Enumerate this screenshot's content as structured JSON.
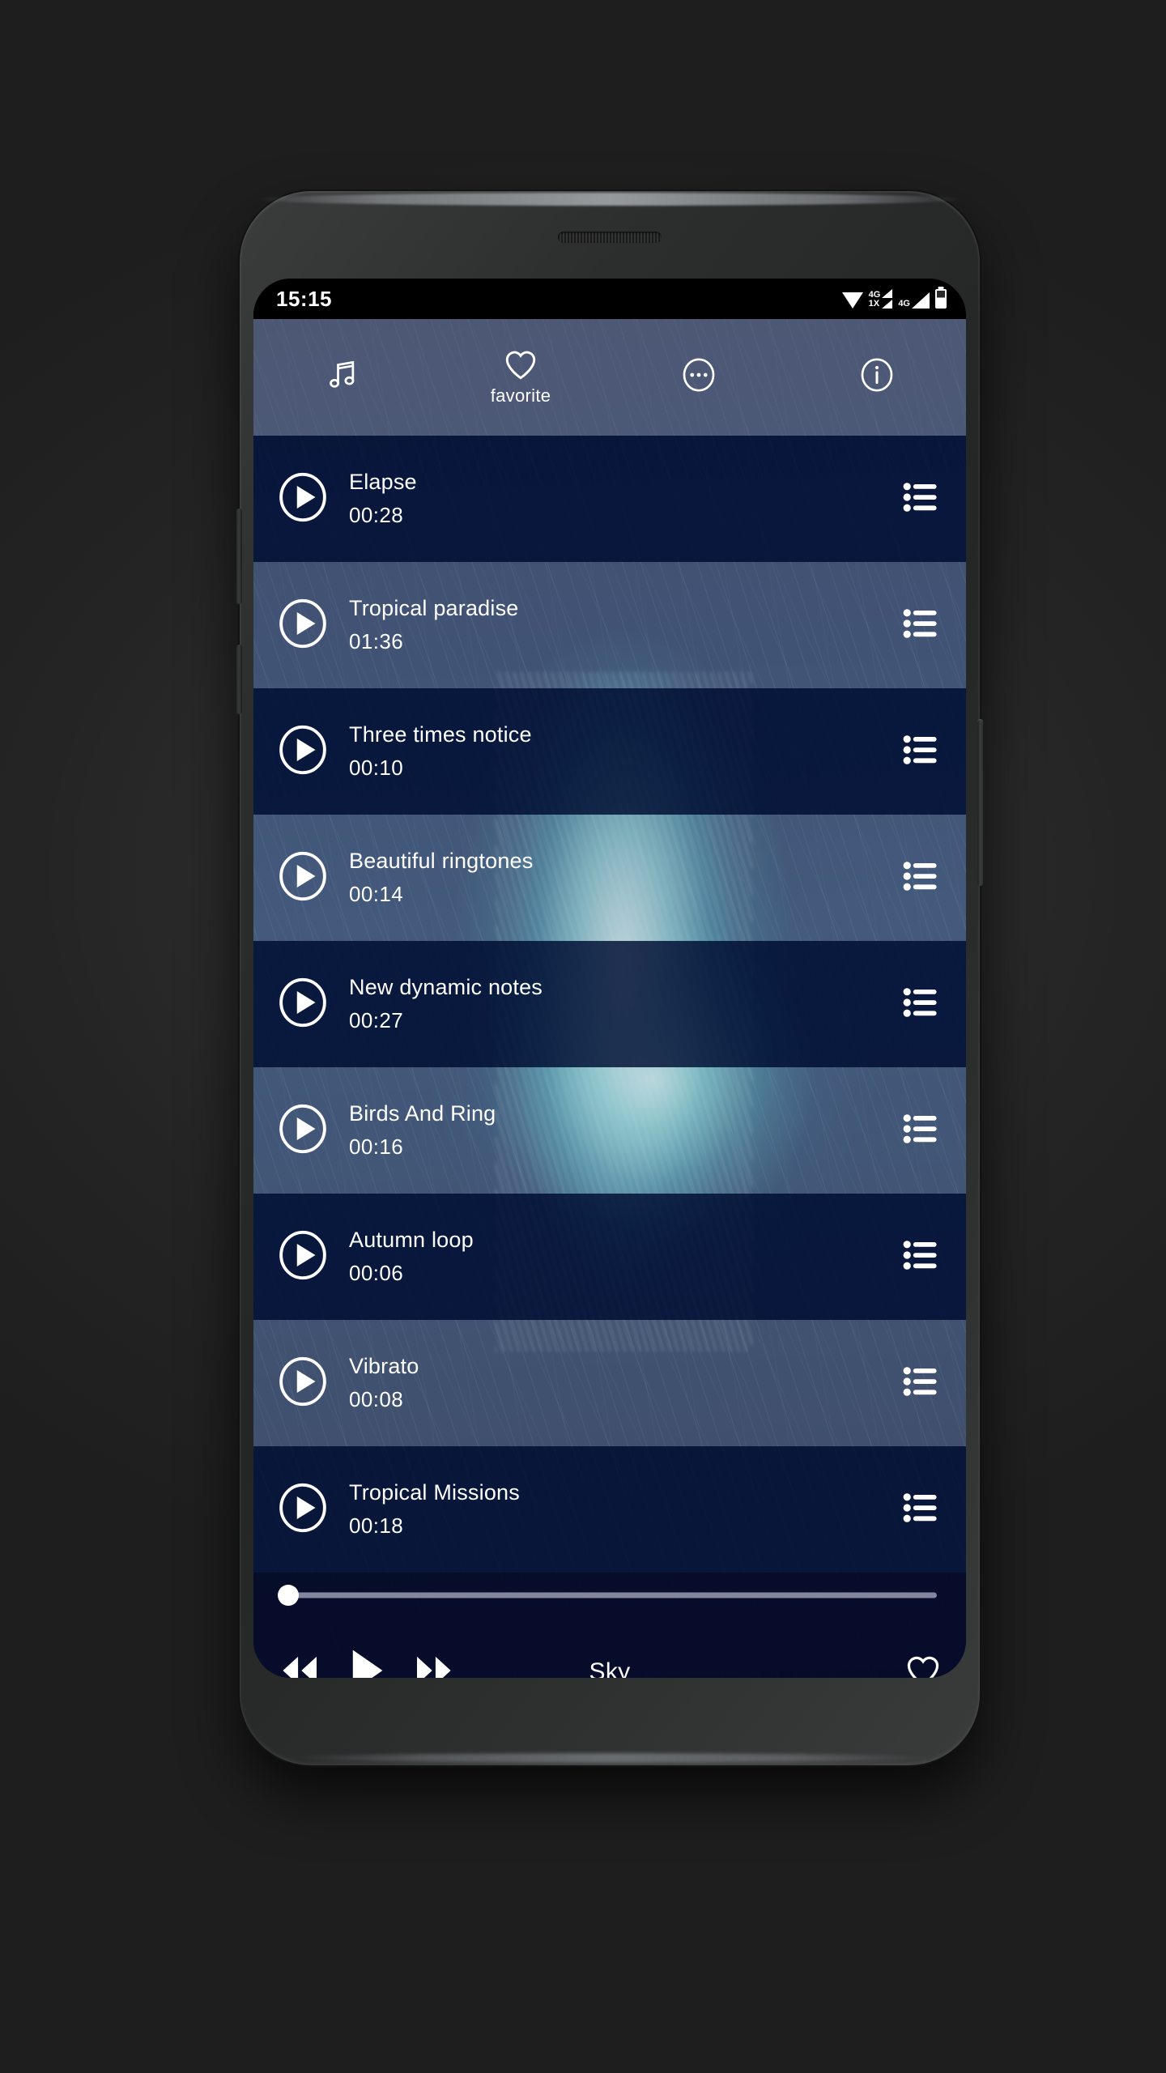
{
  "status_bar": {
    "time": "15:15",
    "icons": [
      "wifi-icon",
      "signal-4g-1x-icon",
      "signal-4g-icon",
      "battery-icon"
    ],
    "signal_1_primary": "4G",
    "signal_1_secondary": "1X",
    "signal_2_primary": "4G"
  },
  "toolbar": {
    "items": [
      {
        "icon": "music-note-icon",
        "label": ""
      },
      {
        "icon": "heart-icon",
        "label": "favorite"
      },
      {
        "icon": "more-circle-icon",
        "label": ""
      },
      {
        "icon": "info-circle-icon",
        "label": ""
      }
    ]
  },
  "list": {
    "items": [
      {
        "title": "Elapse",
        "duration": "00:28",
        "style": "dark",
        "play_icon": "play-circle-icon",
        "menu_icon": "list-menu-icon"
      },
      {
        "title": "Tropical paradise",
        "duration": "01:36",
        "style": "light",
        "play_icon": "play-circle-icon",
        "menu_icon": "list-menu-icon"
      },
      {
        "title": "Three times notice",
        "duration": "00:10",
        "style": "dark",
        "play_icon": "play-circle-icon",
        "menu_icon": "list-menu-icon"
      },
      {
        "title": "Beautiful ringtones",
        "duration": "00:14",
        "style": "light",
        "play_icon": "play-circle-icon",
        "menu_icon": "list-menu-icon"
      },
      {
        "title": "New dynamic notes",
        "duration": "00:27",
        "style": "dark",
        "play_icon": "play-circle-icon",
        "menu_icon": "list-menu-icon"
      },
      {
        "title": "Birds And Ring",
        "duration": "00:16",
        "style": "light",
        "play_icon": "play-circle-icon",
        "menu_icon": "list-menu-icon"
      },
      {
        "title": "Autumn loop",
        "duration": "00:06",
        "style": "dark",
        "play_icon": "play-circle-icon",
        "menu_icon": "list-menu-icon"
      },
      {
        "title": "Vibrato",
        "duration": "00:08",
        "style": "light",
        "play_icon": "play-circle-icon",
        "menu_icon": "list-menu-icon"
      },
      {
        "title": "Tropical Missions",
        "duration": "00:18",
        "style": "dark",
        "play_icon": "play-circle-icon",
        "menu_icon": "list-menu-icon"
      }
    ]
  },
  "player": {
    "now_playing": "Sky",
    "progress_percent": 0,
    "prev_icon": "rewind-icon",
    "play_icon": "play-icon",
    "next_icon": "fast-forward-icon",
    "favorite_icon": "heart-outline-icon"
  },
  "colors": {
    "row_dark": "#08163a",
    "row_light": "#96a0be",
    "toolbar_bg": "#78809b",
    "player_bg": "#060c28",
    "accent_white": "#ffffff",
    "wallpaper_teal": "#6fe6cd"
  }
}
